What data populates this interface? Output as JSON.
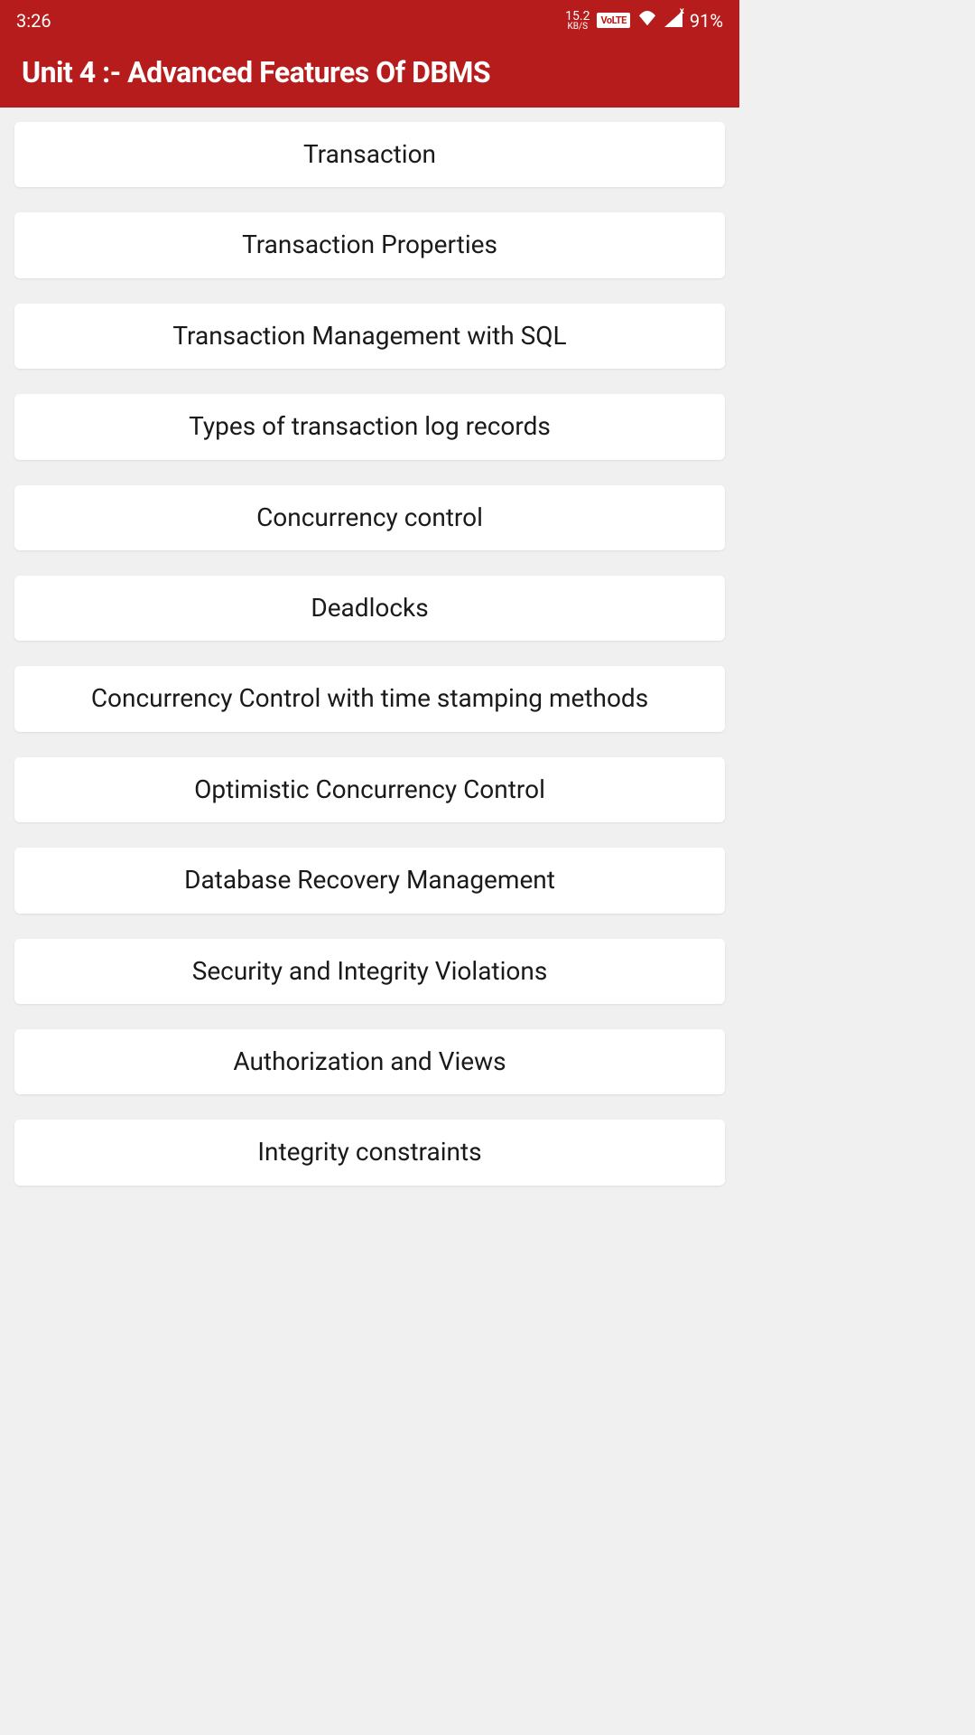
{
  "status_bar": {
    "time": "3:26",
    "data_speed_value": "15.2",
    "data_speed_unit": "KB/S",
    "volte": "VoLTE",
    "battery": "91%"
  },
  "header": {
    "title": "Unit 4 :- Advanced Features Of DBMS"
  },
  "topics": [
    "Transaction",
    "Transaction Properties",
    "Transaction Management with SQL",
    "Types of transaction log records",
    "Concurrency control",
    "Deadlocks",
    "Concurrency Control with time stamping methods",
    "Optimistic Concurrency Control",
    "Database Recovery Management",
    "Security and Integrity Violations",
    "Authorization and Views",
    "Integrity constraints"
  ]
}
